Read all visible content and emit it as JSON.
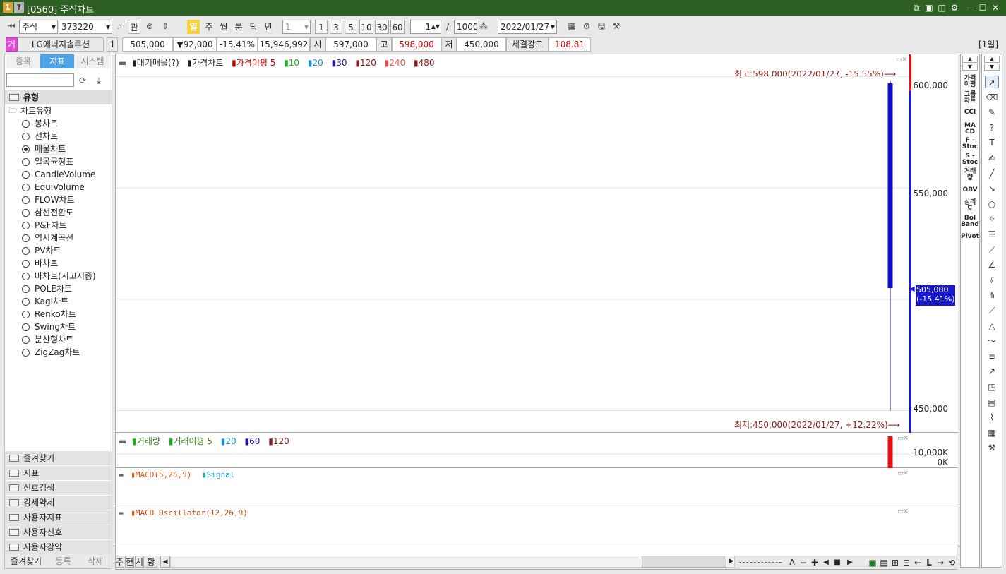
{
  "window": {
    "title": "[0560] 주식차트",
    "badge1": "1",
    "badge2": "?"
  },
  "toolbar": {
    "market_select": "주식",
    "code_input": "373220",
    "gwan_button": "관",
    "period_buttons": [
      "일",
      "주",
      "월",
      "분",
      "틱",
      "년"
    ],
    "interval_select": "1",
    "interval_buttons": [
      "1",
      "3",
      "5",
      "10",
      "30",
      "60"
    ],
    "count_input": "1",
    "separator": "/",
    "total_input": "1000",
    "date_select": "2022/01/27",
    "period_label": "[1일]"
  },
  "info": {
    "exchange_badge": "거",
    "stock_name": "LG에너지솔루션",
    "info_button": "i",
    "price": "505,000",
    "change": "▼92,000",
    "change_pct": "-15.41%",
    "volume": "15,946,992",
    "open_label": "시",
    "open": "597,000",
    "high_label": "고",
    "high": "598,000",
    "low_label": "저",
    "low": "450,000",
    "strength_label": "체결강도",
    "strength": "108.81"
  },
  "left": {
    "tabs": [
      "종목",
      "지표",
      "시스템"
    ],
    "search_placeholder": "",
    "section_title": "유형",
    "tree_root": "차트유형",
    "chart_types": [
      "봉차트",
      "선차트",
      "매물차트",
      "일목균형표",
      "CandleVolume",
      "EquiVolume",
      "FLOW차트",
      "삼선전환도",
      "P&F차트",
      "역시계곡선",
      "PV차트",
      "바차트",
      "바차트(시고저종)",
      "POLE차트",
      "Kagi차트",
      "Renko차트",
      "Swing차트",
      "분산형차트",
      "ZigZag차트"
    ],
    "selected_index": 2,
    "folders": [
      "즐겨찾기",
      "지표",
      "신호검색",
      "강세약세",
      "사용자지표",
      "사용자신호",
      "사용자강약"
    ],
    "bottom_tabs": [
      "즐겨찾기",
      "등록",
      "삭제"
    ]
  },
  "chart": {
    "price_legend": [
      "대기매물(?)",
      "가격차트",
      "가격이평 5",
      "10",
      "20",
      "30",
      "120",
      "240",
      "480"
    ],
    "high_annotation": "최고:598,000(2022/01/27, -15.55%)⟶",
    "low_annotation": "최저:450,000(2022/01/27, +12.22%)⟶",
    "price_axis": [
      "600,000",
      "550,000",
      "450,000"
    ],
    "current_price_tag": "505,000",
    "current_pct_tag": "(-15.41%)",
    "volume_legend": [
      "거래량",
      "거래이평 5",
      "20",
      "60",
      "120"
    ],
    "volume_axis": [
      "10,000K",
      "0K"
    ],
    "macd_legend": [
      "MACD(5,25,5)",
      "Signal"
    ],
    "macd_osc_legend": "MACD Oscillator(12,26,9)",
    "colors": {
      "bar_blue": "#1010c8",
      "vol_red": "#e81010",
      "annotation": "#8b1b1b",
      "tag_bg": "#1818d0"
    }
  },
  "chart_data": {
    "type": "bar",
    "candle": {
      "date": "2022/01/27",
      "open": 597000,
      "high": 598000,
      "low": 450000,
      "close": 505000
    },
    "ylim": [
      440000,
      610000
    ],
    "volume": {
      "value": 15946992,
      "ylim": [
        0,
        17000000
      ]
    }
  },
  "bottom": {
    "tabs": [
      "주",
      "현",
      "시",
      "황"
    ]
  },
  "right_panel": {
    "indicators": [
      "가격\n이평",
      "그룹\n차트",
      "CCI",
      "MA\nCD",
      "F -\nStoc",
      "S -\nStoc",
      "거래\n량",
      "OBV",
      "심리\n도",
      "Bol\nBand",
      "Pivot"
    ]
  },
  "tools": [
    "arrow-cursor",
    "eraser",
    "all-erase",
    "help",
    "text",
    "pen",
    "line",
    "trend-line",
    "circle",
    "fibo",
    "equal-lines",
    "gann",
    "angle",
    "parallel",
    "harmonic",
    "speed",
    "triangle",
    "wave",
    "cycle",
    "auto-trend",
    "window",
    "print",
    "chart-line",
    "data",
    "wrench"
  ]
}
